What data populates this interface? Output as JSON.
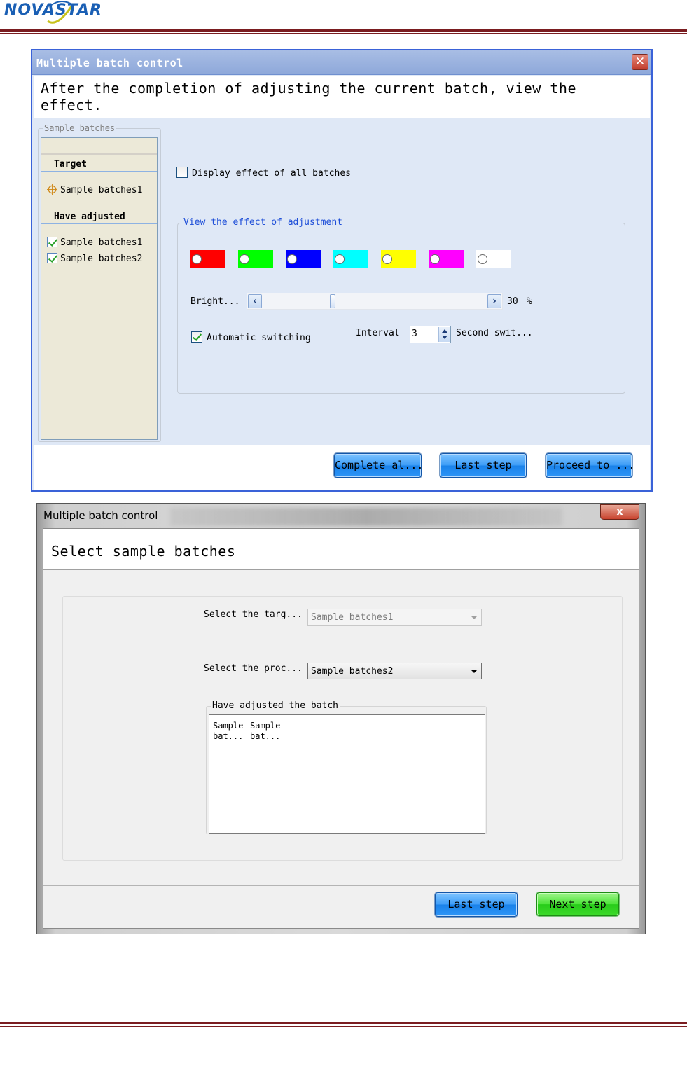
{
  "logo": {
    "nova": "NOVA",
    "star": "STAR"
  },
  "dialog1": {
    "title": "Multiple batch control",
    "close_glyph": "✕",
    "instruction": "After the completion of adjusting the current batch, view the effect.",
    "sample_group_legend": "Sample batches",
    "tree": {
      "target_header": "Target",
      "target_item": "Sample batches1",
      "adjusted_header": "Have adjusted",
      "adjusted_items": [
        "Sample batches1",
        "Sample batches2"
      ]
    },
    "display_all_label": "Display effect of all batches",
    "display_all_checked": false,
    "view_group_legend": "View the effect of adjustment",
    "swatch_colors": [
      "#ff0000",
      "#00ff00",
      "#0000ff",
      "#00ffff",
      "#ffff00",
      "#ff00ff",
      "#ffffff"
    ],
    "brightness_label": "Bright...",
    "brightness_value": "30",
    "brightness_fraction": 0.3,
    "percent_sign": "%",
    "auto_switch_label": "Automatic switching",
    "auto_switch_checked": true,
    "interval_label": "Interval",
    "interval_value": "3",
    "second_label": "Second swit...",
    "buttons": {
      "complete": "Complete al...",
      "last": "Last step",
      "proceed": "Proceed to ..."
    }
  },
  "dialog2": {
    "title": "Multiple batch control",
    "close_glyph": "x",
    "instruction": "Select sample batches",
    "select_target_label": "Select the targ...",
    "select_target_value": "Sample batches1",
    "select_proc_label": "Select the proc...",
    "select_proc_value": "Sample batches2",
    "adjusted_legend": "Have adjusted the batch",
    "adjusted_list": [
      {
        "line1": "Sample",
        "line2": "bat..."
      },
      {
        "line1": "Sample",
        "line2": "bat..."
      }
    ],
    "buttons": {
      "last": "Last step",
      "next": "Next step"
    }
  },
  "icons": {
    "close": "close-icon",
    "target": "crosshair-icon",
    "check": "checkmark-icon",
    "arrow_left": "chevron-left-icon",
    "arrow_right": "chevron-right-icon",
    "spin": "spinner-arrows-icon",
    "dropdown": "chevron-down-icon"
  }
}
